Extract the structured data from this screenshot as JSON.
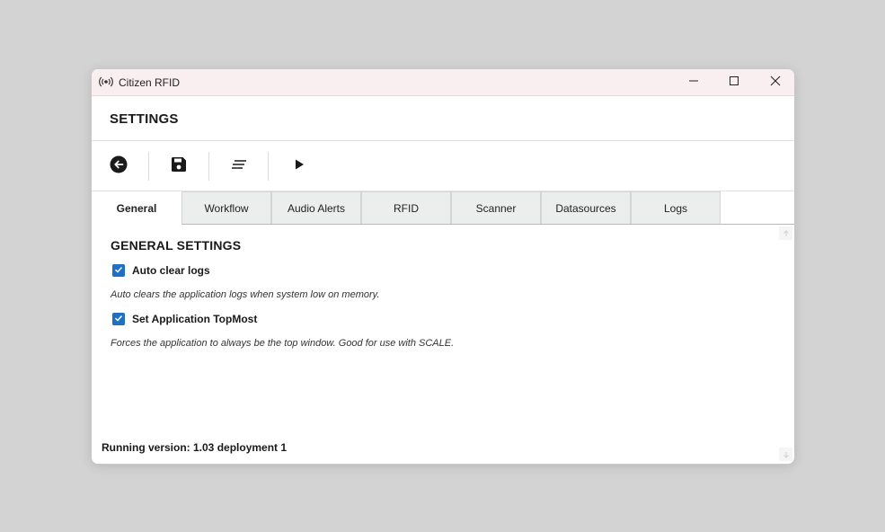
{
  "window": {
    "title": "Citizen RFID"
  },
  "header": {
    "title": "SETTINGS"
  },
  "toolbar": {
    "buttons": [
      {
        "name": "back",
        "icon": "back-arrow-icon"
      },
      {
        "name": "save",
        "icon": "floppy-disk-icon"
      },
      {
        "name": "menu",
        "icon": "lines-icon"
      },
      {
        "name": "run",
        "icon": "play-icon"
      }
    ]
  },
  "tabs": [
    {
      "label": "General",
      "active": true
    },
    {
      "label": "Workflow",
      "active": false
    },
    {
      "label": "Audio Alerts",
      "active": false
    },
    {
      "label": "RFID",
      "active": false
    },
    {
      "label": "Scanner",
      "active": false
    },
    {
      "label": "Datasources",
      "active": false
    },
    {
      "label": "Logs",
      "active": false
    }
  ],
  "general": {
    "section_title": "GENERAL SETTINGS",
    "settings": [
      {
        "label": "Auto clear logs",
        "checked": true,
        "description": "Auto clears the application logs when system low on memory."
      },
      {
        "label": "Set Application TopMost",
        "checked": true,
        "description": "Forces the application to always be the top window. Good for use with SCALE."
      }
    ]
  },
  "footer": {
    "version_text": "Running version: 1.03 deployment 1"
  },
  "colors": {
    "checkbox": "#1f6fc5",
    "titlebar": "#f9eff1",
    "tab_inactive": "#eceeee"
  }
}
